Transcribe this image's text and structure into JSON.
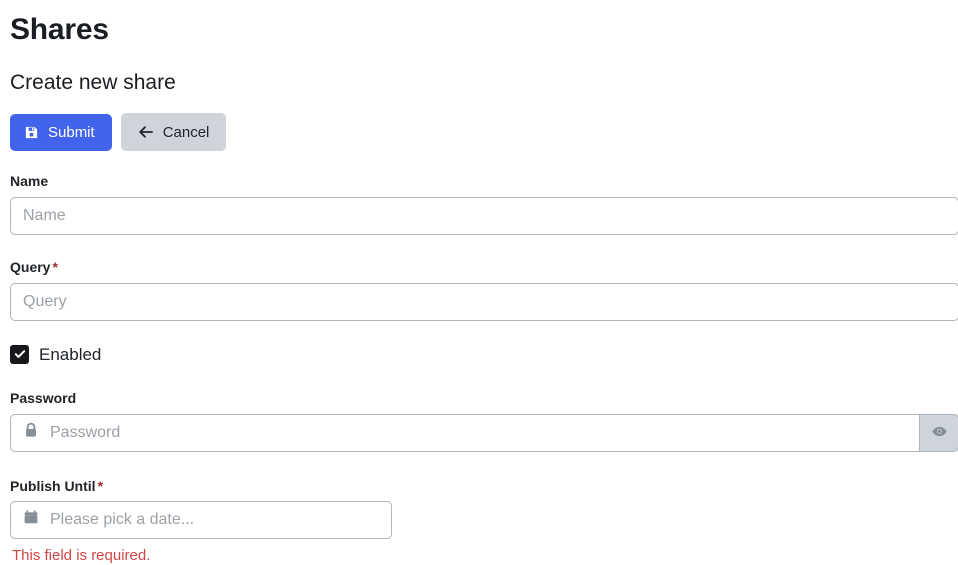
{
  "page": {
    "title": "Shares",
    "section_title": "Create new share"
  },
  "toolbar": {
    "submit_label": "Submit",
    "cancel_label": "Cancel",
    "submit_icon": "save-floppy-icon",
    "cancel_icon": "arrow-left-icon",
    "submit_color": "#4263eb",
    "cancel_color": "#ced4da"
  },
  "form": {
    "name": {
      "label": "Name",
      "placeholder": "Name",
      "value": "",
      "required": false
    },
    "query": {
      "label": "Query",
      "placeholder": "Query",
      "value": "",
      "required": true,
      "required_marker": "*"
    },
    "enabled": {
      "label": "Enabled",
      "checked": true,
      "check_glyph": "✔"
    },
    "password": {
      "label": "Password",
      "placeholder": "Password",
      "value": "",
      "lock_icon": "lock-icon",
      "toggle_icon": "eye-icon"
    },
    "publish_until": {
      "label": "Publish Until",
      "placeholder": "Please pick a date...",
      "value": "",
      "required": true,
      "required_marker": "*",
      "calendar_icon": "calendar-icon",
      "error": "This field is required.",
      "error_color": "#d24545"
    }
  }
}
